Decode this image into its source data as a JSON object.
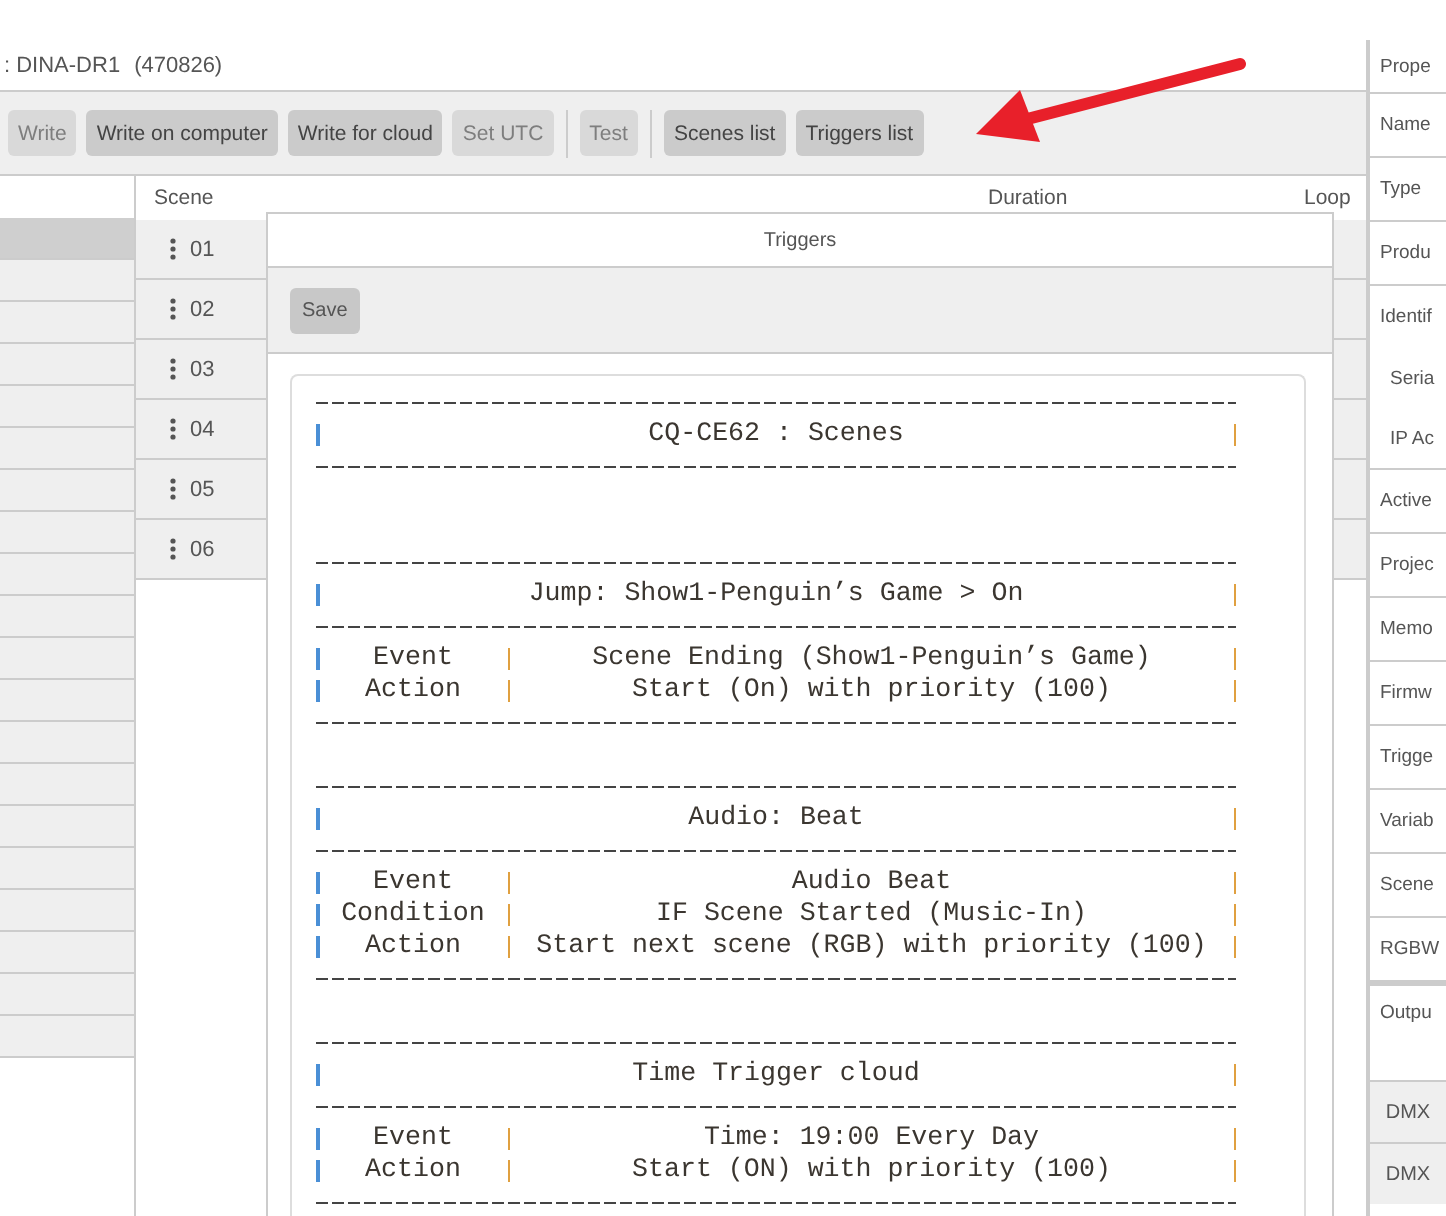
{
  "header": {
    "device": ": DINA-DR1",
    "serial": "(470826)"
  },
  "toolbar": [
    {
      "kind": "button",
      "label": "Write",
      "disabled": true
    },
    {
      "kind": "button",
      "label": "Write on computer",
      "disabled": false
    },
    {
      "kind": "button",
      "label": "Write for cloud",
      "disabled": false
    },
    {
      "kind": "button",
      "label": "Set UTC",
      "disabled": true
    },
    {
      "kind": "separator"
    },
    {
      "kind": "button",
      "label": "Test",
      "disabled": true
    },
    {
      "kind": "separator"
    },
    {
      "kind": "button",
      "label": "Scenes list",
      "disabled": false
    },
    {
      "kind": "button",
      "label": "Triggers list",
      "disabled": false
    }
  ],
  "left_list": [
    {
      "selected": true
    },
    {
      "selected": false
    },
    {
      "selected": false
    },
    {
      "selected": false
    },
    {
      "selected": false
    },
    {
      "selected": false
    },
    {
      "selected": false
    },
    {
      "selected": false
    },
    {
      "selected": false
    },
    {
      "selected": false
    },
    {
      "selected": false
    },
    {
      "selected": false
    },
    {
      "selected": false
    },
    {
      "selected": false
    },
    {
      "selected": false
    },
    {
      "selected": false
    },
    {
      "selected": false
    },
    {
      "selected": false
    },
    {
      "selected": false
    },
    {
      "selected": false
    }
  ],
  "scene_table": {
    "columns": [
      "Scene",
      "Duration",
      "Loop"
    ],
    "rows": [
      {
        "number": "01"
      },
      {
        "number": "02"
      },
      {
        "number": "03"
      },
      {
        "number": "04"
      },
      {
        "number": "05"
      },
      {
        "number": "06"
      }
    ]
  },
  "dialog": {
    "title": "Triggers",
    "save_button": "Save",
    "report_title": "CQ-CE62 : Scenes",
    "triggers": [
      {
        "title": "Jump: Show1-Penguin’s Game > On",
        "rows": [
          {
            "label": "Event",
            "value": "Scene Ending (Show1-Penguin’s Game)"
          },
          {
            "label": "Action",
            "value": "Start (On) with priority (100)"
          }
        ]
      },
      {
        "title": "Audio: Beat",
        "rows": [
          {
            "label": "Event",
            "value": "Audio Beat"
          },
          {
            "label": "Condition",
            "value": "IF Scene Started (Music-In)"
          },
          {
            "label": "Action",
            "value": "Start next scene (RGB) with priority (100)"
          }
        ]
      },
      {
        "title": "Time Trigger cloud",
        "rows": [
          {
            "label": "Event",
            "value": "Time: 19:00 Every Day"
          },
          {
            "label": "Action",
            "value": "Start (ON) with priority (100)"
          }
        ]
      }
    ]
  },
  "properties": [
    {
      "kind": "header",
      "label": "Prope"
    },
    {
      "kind": "field",
      "label": "Name"
    },
    {
      "kind": "field",
      "label": "Type"
    },
    {
      "kind": "field",
      "label": "Produ"
    },
    {
      "kind": "group",
      "label": "Identif"
    },
    {
      "kind": "sub",
      "label": "Seria"
    },
    {
      "kind": "sub",
      "label": "IP Ac"
    },
    {
      "kind": "field",
      "label": "Active"
    },
    {
      "kind": "field",
      "label": "Projec"
    },
    {
      "kind": "field",
      "label": "Memo"
    },
    {
      "kind": "field",
      "label": "Firmw"
    },
    {
      "kind": "field",
      "label": "Trigge"
    },
    {
      "kind": "field",
      "label": "Variab"
    },
    {
      "kind": "field",
      "label": "Scene"
    },
    {
      "kind": "field",
      "label": "RGBW"
    },
    {
      "kind": "section",
      "label": "Outpu"
    },
    {
      "kind": "dmx",
      "label": "DMX"
    },
    {
      "kind": "dmx",
      "label": "DMX"
    }
  ]
}
